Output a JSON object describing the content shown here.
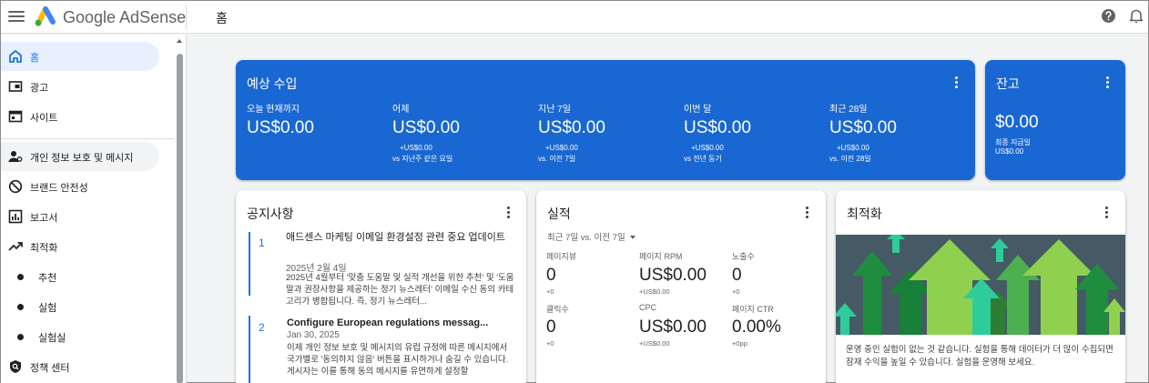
{
  "app": {
    "name": "Google AdSense",
    "page_title": "홈"
  },
  "sidebar": {
    "items": [
      {
        "label": "홈",
        "icon": "home-icon",
        "active": true
      },
      {
        "label": "광고",
        "icon": "ads-icon"
      },
      {
        "label": "사이트",
        "icon": "sites-icon"
      },
      {
        "label": "개인 정보 보호 및 메시지",
        "icon": "privacy-icon"
      },
      {
        "label": "브랜드 안전성",
        "icon": "block-icon"
      },
      {
        "label": "보고서",
        "icon": "reports-icon"
      },
      {
        "label": "최적화",
        "icon": "trending-up-icon"
      }
    ],
    "sub_items": [
      {
        "label": "추천"
      },
      {
        "label": "실험"
      },
      {
        "label": "실험실"
      }
    ],
    "policy": {
      "label": "정책 센터",
      "icon": "policy-icon"
    }
  },
  "estimated": {
    "title": "예상 수입",
    "columns": [
      {
        "label": "오늘 현재까지",
        "value": "US$0.00",
        "delta": "",
        "vs": ""
      },
      {
        "label": "어제",
        "value": "US$0.00",
        "delta": "+US$0.00",
        "vs": "vs 지난주 같은 요일"
      },
      {
        "label": "지난 7일",
        "value": "US$0.00",
        "delta": "+US$0.00",
        "vs": "vs. 이전 7일"
      },
      {
        "label": "이번 달",
        "value": "US$0.00",
        "delta": "+US$0.00",
        "vs": "vs 전년 동기"
      },
      {
        "label": "최근 28일",
        "value": "US$0.00",
        "delta": "+US$0.00",
        "vs": "vs. 이전 28일"
      }
    ]
  },
  "balance": {
    "title": "잔고",
    "value": "$0.00",
    "last_payment_label": "최종 지급일",
    "last_payment_value": "US$0.00"
  },
  "notices": {
    "title": "공지사항",
    "items": [
      {
        "num": "1",
        "title": "애드센스 마케팅 이메일 환경설정 관련 중요 업데이트",
        "date": "2025년 2월 4일",
        "body": "2025년 4월부터 '맞춤 도움말 및 실적 개선을 위한 추천' 및 '도움말과 권장사항을 제공하는 정기 뉴스레터' 이메일 수신 동의 카테고리가 병합됩니다. 즉, 정기 뉴스레터..."
      },
      {
        "num": "2",
        "title": "Configure European regulations messag...",
        "date": "Jan 30, 2025",
        "body": "이제 개인 정보 보호 및 메시지의 유럽 규정에 따른 메시지에서 국가별로 '동의하지 않음' 버튼을 표시하거나 숨길 수 있습니다. 게시자는 이를 통해 동의 메시지를 유연하게 설정할"
      }
    ]
  },
  "performance": {
    "title": "실적",
    "range": "최근 7일 vs. 이전 7일",
    "metrics": [
      {
        "label": "페이지뷰",
        "value": "0",
        "delta": "+0"
      },
      {
        "label": "페이지 RPM",
        "value": "US$0.00",
        "delta": "+US$0.00"
      },
      {
        "label": "노출수",
        "value": "0",
        "delta": "+0"
      },
      {
        "label": "클릭수",
        "value": "0",
        "delta": "+0"
      },
      {
        "label": "CPC",
        "value": "US$0.00",
        "delta": "+US$0.00"
      },
      {
        "label": "페이지 CTR",
        "value": "0.00%",
        "delta": "+0pp"
      }
    ]
  },
  "optimization": {
    "title": "최적화",
    "text": "운영 중인 실험이 없는 것 같습니다. 실험을 통해 데이터가 더 많이 수집되면 잠재 수익을 높일 수 있습니다. 실험을 운영해 보세요."
  },
  "colors": {
    "primary_blue": "#1967d2",
    "active_nav_bg": "#e8f0fe",
    "accent": "#1a73e8",
    "arrow_green": "#8fd14f"
  }
}
